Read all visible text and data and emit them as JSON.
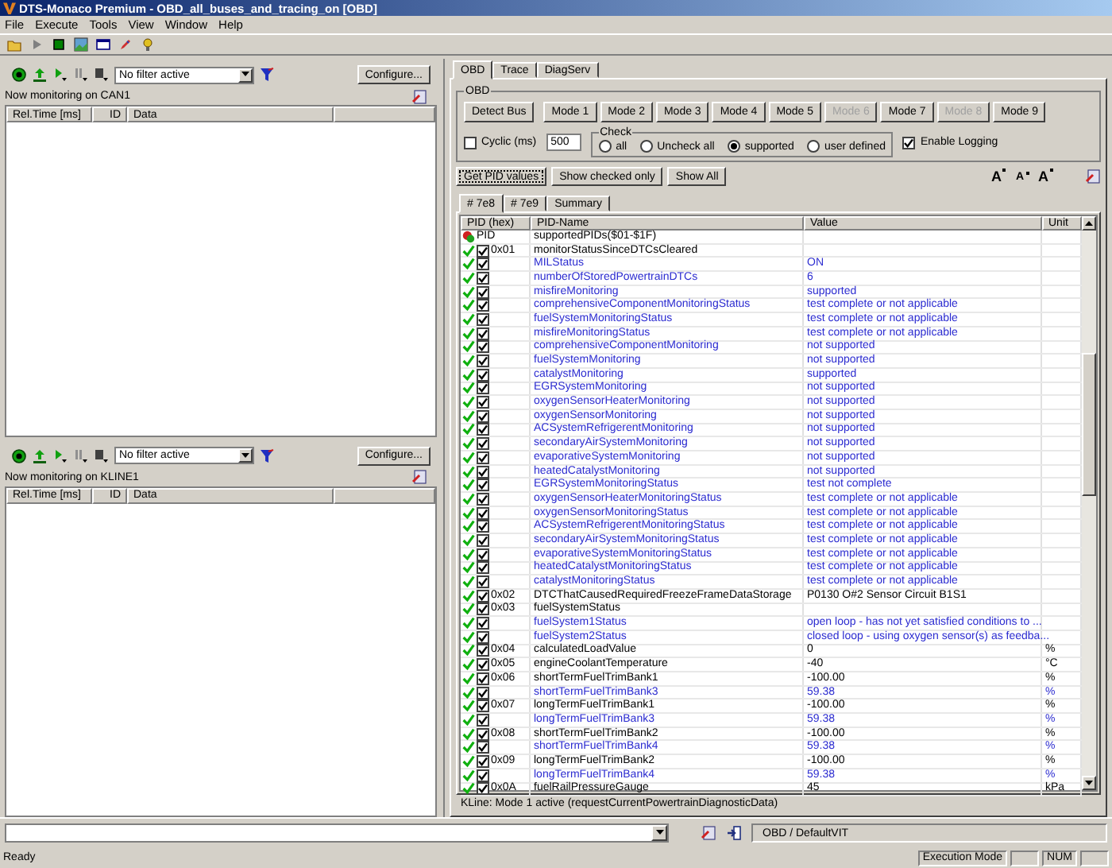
{
  "window": {
    "title": "DTS-Monaco Premium - OBD_all_buses_and_tracing_on [OBD]"
  },
  "menu": [
    "File",
    "Execute",
    "Tools",
    "View",
    "Window",
    "Help"
  ],
  "monitors": [
    {
      "filter": "No filter active",
      "configure": "Configure...",
      "label": "Now monitoring on CAN1",
      "columns": [
        "Rel.Time [ms]",
        "ID",
        "Data"
      ]
    },
    {
      "filter": "No filter active",
      "configure": "Configure...",
      "label": "Now monitoring on KLINE1",
      "columns": [
        "Rel.Time [ms]",
        "ID",
        "Data"
      ]
    }
  ],
  "tabs": [
    {
      "label": "OBD",
      "selected": true
    },
    {
      "label": "Trace",
      "selected": false
    },
    {
      "label": "DiagServ",
      "selected": false
    }
  ],
  "obd": {
    "group_title": "OBD",
    "detect": "Detect Bus",
    "modes": [
      {
        "label": "Mode 1",
        "disabled": false
      },
      {
        "label": "Mode 2",
        "disabled": false
      },
      {
        "label": "Mode 3",
        "disabled": false
      },
      {
        "label": "Mode 4",
        "disabled": false
      },
      {
        "label": "Mode 5",
        "disabled": false
      },
      {
        "label": "Mode 6",
        "disabled": true
      },
      {
        "label": "Mode 7",
        "disabled": false
      },
      {
        "label": "Mode 8",
        "disabled": true
      },
      {
        "label": "Mode 9",
        "disabled": false
      }
    ],
    "cyclic": {
      "label": "Cyclic (ms)",
      "checked": false,
      "value": "500"
    },
    "check": {
      "title": "Check",
      "options": [
        {
          "label": "all",
          "selected": false
        },
        {
          "label": "Uncheck all",
          "selected": false
        },
        {
          "label": "supported",
          "selected": true
        },
        {
          "label": "user defined",
          "selected": false
        }
      ]
    },
    "logging": {
      "label": "Enable Logging",
      "checked": true
    },
    "actions": [
      "Get PID values",
      "Show checked only",
      "Show All"
    ],
    "font_buttons": [
      "A",
      "A",
      "A"
    ],
    "subtabs": [
      {
        "label": "# 7e8",
        "selected": true
      },
      {
        "label": "# 7e9",
        "selected": false
      },
      {
        "label": "Summary",
        "selected": false
      }
    ],
    "table": {
      "columns": [
        "PID (hex)",
        "PID-Name",
        "Value",
        "Unit"
      ],
      "rows": [
        {
          "kind": "header",
          "pid": "PID",
          "name": "supportedPIDs($01-$1F)"
        },
        {
          "kind": "pid",
          "pid": "0x01",
          "name": "monitorStatusSinceDTCsCleared",
          "checked": true
        },
        {
          "kind": "sub",
          "name": "MILStatus",
          "value": "ON",
          "checked": true
        },
        {
          "kind": "sub",
          "name": "numberOfStoredPowertrainDTCs",
          "value": "6",
          "checked": true
        },
        {
          "kind": "sub",
          "name": "misfireMonitoring",
          "value": "supported",
          "checked": true
        },
        {
          "kind": "sub",
          "name": "comprehensiveComponentMonitoringStatus",
          "value": "test complete or not applicable",
          "checked": true
        },
        {
          "kind": "sub",
          "name": "fuelSystemMonitoringStatus",
          "value": "test complete or not applicable",
          "checked": true
        },
        {
          "kind": "sub",
          "name": "misfireMonitoringStatus",
          "value": "test complete or not applicable",
          "checked": true
        },
        {
          "kind": "sub",
          "name": "comprehensiveComponentMonitoring",
          "value": "not supported",
          "checked": true
        },
        {
          "kind": "sub",
          "name": "fuelSystemMonitoring",
          "value": "not supported",
          "checked": true
        },
        {
          "kind": "sub",
          "name": "catalystMonitoring",
          "value": "supported",
          "checked": true
        },
        {
          "kind": "sub",
          "name": "EGRSystemMonitoring",
          "value": "not supported",
          "checked": true
        },
        {
          "kind": "sub",
          "name": "oxygenSensorHeaterMonitoring",
          "value": "not supported",
          "checked": true
        },
        {
          "kind": "sub",
          "name": "oxygenSensorMonitoring",
          "value": "not supported",
          "checked": true
        },
        {
          "kind": "sub",
          "name": "ACSystemRefrigerentMonitoring",
          "value": "not supported",
          "checked": true
        },
        {
          "kind": "sub",
          "name": "secondaryAirSystemMonitoring",
          "value": "not supported",
          "checked": true
        },
        {
          "kind": "sub",
          "name": "evaporativeSystemMonitoring",
          "value": "not supported",
          "checked": true
        },
        {
          "kind": "sub",
          "name": "heatedCatalystMonitoring",
          "value": "not supported",
          "checked": true
        },
        {
          "kind": "sub",
          "name": "EGRSystemMonitoringStatus",
          "value": "test not complete",
          "checked": true
        },
        {
          "kind": "sub",
          "name": "oxygenSensorHeaterMonitoringStatus",
          "value": "test complete or not applicable",
          "checked": true
        },
        {
          "kind": "sub",
          "name": "oxygenSensorMonitoringStatus",
          "value": "test complete or not applicable",
          "checked": true
        },
        {
          "kind": "sub",
          "name": "ACSystemRefrigerentMonitoringStatus",
          "value": "test complete or not applicable",
          "checked": true
        },
        {
          "kind": "sub",
          "name": "secondaryAirSystemMonitoringStatus",
          "value": "test complete or not applicable",
          "checked": true
        },
        {
          "kind": "sub",
          "name": "evaporativeSystemMonitoringStatus",
          "value": "test complete or not applicable",
          "checked": true
        },
        {
          "kind": "sub",
          "name": "heatedCatalystMonitoringStatus",
          "value": "test complete or not applicable",
          "checked": true
        },
        {
          "kind": "sub",
          "name": "catalystMonitoringStatus",
          "value": "test complete or not applicable",
          "checked": true
        },
        {
          "kind": "pid",
          "pid": "0x02",
          "name": "DTCThatCausedRequiredFreezeFrameDataStorage",
          "value": "P0130 O#2 Sensor Circuit B1S1",
          "checked": true
        },
        {
          "kind": "pid",
          "pid": "0x03",
          "name": "fuelSystemStatus",
          "checked": true
        },
        {
          "kind": "sub",
          "name": "fuelSystem1Status",
          "value": "open loop - has not yet satisfied conditions to ...",
          "checked": true
        },
        {
          "kind": "sub",
          "name": "fuelSystem2Status",
          "value": "closed loop - using oxygen sensor(s) as feedba...",
          "checked": true
        },
        {
          "kind": "pid",
          "pid": "0x04",
          "name": "calculatedLoadValue",
          "value": "0",
          "unit": "%",
          "checked": true
        },
        {
          "kind": "pid",
          "pid": "0x05",
          "name": "engineCoolantTemperature",
          "value": "-40",
          "unit": "°C",
          "checked": true
        },
        {
          "kind": "pid",
          "pid": "0x06",
          "name": "shortTermFuelTrimBank1",
          "value": "-100.00",
          "unit": "%",
          "checked": true
        },
        {
          "kind": "sub",
          "name": "shortTermFuelTrimBank3",
          "value": "59.38",
          "unit": "%",
          "checked": true
        },
        {
          "kind": "pid",
          "pid": "0x07",
          "name": "longTermFuelTrimBank1",
          "value": "-100.00",
          "unit": "%",
          "checked": true
        },
        {
          "kind": "sub",
          "name": "longTermFuelTrimBank3",
          "value": "59.38",
          "unit": "%",
          "checked": true
        },
        {
          "kind": "pid",
          "pid": "0x08",
          "name": "shortTermFuelTrimBank2",
          "value": "-100.00",
          "unit": "%",
          "checked": true
        },
        {
          "kind": "sub",
          "name": "shortTermFuelTrimBank4",
          "value": "59.38",
          "unit": "%",
          "checked": true
        },
        {
          "kind": "pid",
          "pid": "0x09",
          "name": "longTermFuelTrimBank2",
          "value": "-100.00",
          "unit": "%",
          "checked": true
        },
        {
          "kind": "sub",
          "name": "longTermFuelTrimBank4",
          "value": "59.38",
          "unit": "%",
          "checked": true
        },
        {
          "kind": "pid",
          "pid": "0x0A",
          "name": "fuelRailPressureGauge",
          "value": "45",
          "unit": "kPa",
          "checked": true
        }
      ]
    },
    "status": "KLine: Mode 1 active (requestCurrentPowertrainDiagnosticData)"
  },
  "command_bar": {
    "context": "OBD / DefaultVIT"
  },
  "status_bar": {
    "text": "Ready",
    "panes": [
      "Execution Mode",
      "NUM"
    ]
  }
}
